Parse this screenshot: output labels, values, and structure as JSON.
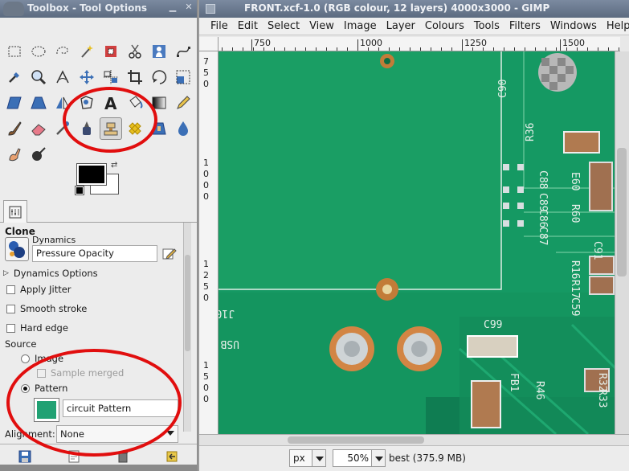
{
  "toolbox": {
    "title": "Toolbox - Tool Options",
    "colors": {
      "foreground": "#000000",
      "background": "#ffffff"
    },
    "tools": [
      "rect-select-icon",
      "ellipse-select-icon",
      "free-select-icon",
      "fuzzy-select-icon",
      "color-select-icon",
      "scissors-select-icon",
      "foreground-select-icon",
      "paths-icon",
      "color-picker-icon",
      "zoom-icon",
      "measure-icon",
      "move-icon",
      "align-icon",
      "crop-icon",
      "rotate-icon",
      "scale-icon",
      "shear-icon",
      "perspective-icon",
      "flip-icon",
      "cage-icon",
      "text-icon",
      "bucket-fill-icon",
      "blend-icon",
      "pencil-icon",
      "paintbrush-icon",
      "eraser-icon",
      "airbrush-icon",
      "ink-icon",
      "clone-icon",
      "heal-icon",
      "perspective-clone-icon",
      "blur-icon",
      "smudge-icon",
      "dodge-burn-icon"
    ],
    "active_tool": "clone-icon"
  },
  "tool_options": {
    "title": "Clone",
    "dynamics_label": "Dynamics",
    "dynamics_value": "Pressure Opacity",
    "dynamics_options": "Dynamics Options",
    "apply_jitter": "Apply Jitter",
    "smooth_stroke": "Smooth stroke",
    "hard_edge": "Hard edge",
    "source_label": "Source",
    "source_image": "Image",
    "sample_merged": "Sample merged",
    "source_pattern": "Pattern",
    "pattern_name": "circuit Pattern",
    "pattern_color": "#21a173",
    "alignment_label": "Alignment:",
    "alignment_value": "None"
  },
  "image_window": {
    "title": "FRONT.xcf-1.0 (RGB colour, 12 layers) 4000x3000 - GIMP",
    "menus": [
      "File",
      "Edit",
      "Select",
      "View",
      "Image",
      "Layer",
      "Colours",
      "Tools",
      "Filters",
      "Windows",
      "Help"
    ],
    "ruler_top": [
      "750",
      "1000",
      "1250",
      "1500"
    ],
    "ruler_left": [
      "750",
      "1000",
      "1250",
      "1500"
    ],
    "pcb_labels": [
      "C90",
      "R36",
      "C88",
      "C89",
      "C86",
      "C87",
      "E60",
      "R60",
      "R16",
      "R17",
      "C59",
      "C91",
      "C99",
      "J10",
      "USB",
      "R46",
      "R32",
      "R33",
      "FB1"
    ],
    "status": {
      "unit": "px",
      "zoom": "50%",
      "info": "best (375.9 MB)"
    }
  }
}
